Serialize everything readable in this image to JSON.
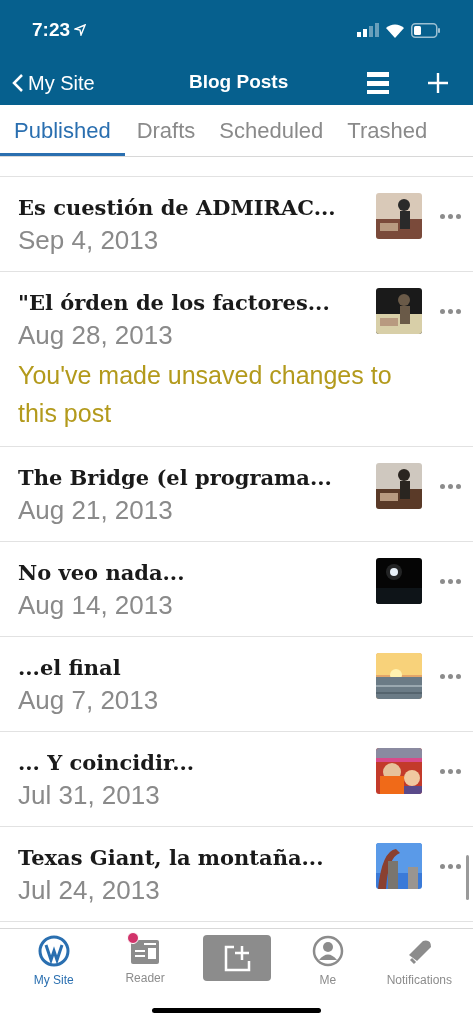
{
  "status_bar": {
    "time": "7:23"
  },
  "nav": {
    "back": "My Site",
    "title": "Blog Posts"
  },
  "tabs": [
    {
      "label": "Published",
      "selected": true
    },
    {
      "label": "Drafts",
      "selected": false
    },
    {
      "label": "Scheduled",
      "selected": false
    },
    {
      "label": "Trashed",
      "selected": false
    }
  ],
  "posts": [
    {
      "title": "Es cuestión de ADMIRAC...",
      "date": "Sep 4, 2013"
    },
    {
      "title": "\"El órden de los factores...",
      "date": "Aug 28, 2013",
      "notice": "You've made unsaved changes to this post"
    },
    {
      "title": "The Bridge (el programa...",
      "date": "Aug 21, 2013"
    },
    {
      "title": "No veo nada...",
      "date": "Aug 14, 2013"
    },
    {
      "title": "...el final",
      "date": "Aug 7, 2013"
    },
    {
      "title": "... Y coincidir...",
      "date": "Jul 31, 2013"
    },
    {
      "title": "Texas Giant, la montaña...",
      "date": "Jul 24, 2013"
    }
  ],
  "tab_bar": [
    {
      "kind": "site",
      "label": "My Site",
      "selected": true
    },
    {
      "kind": "reader",
      "label": "Reader",
      "selected": false,
      "badge": true
    },
    {
      "kind": "compose",
      "selected": false
    },
    {
      "kind": "me",
      "label": "Me",
      "selected": false
    },
    {
      "kind": "notifications",
      "label": "Notifications",
      "selected": false
    }
  ]
}
